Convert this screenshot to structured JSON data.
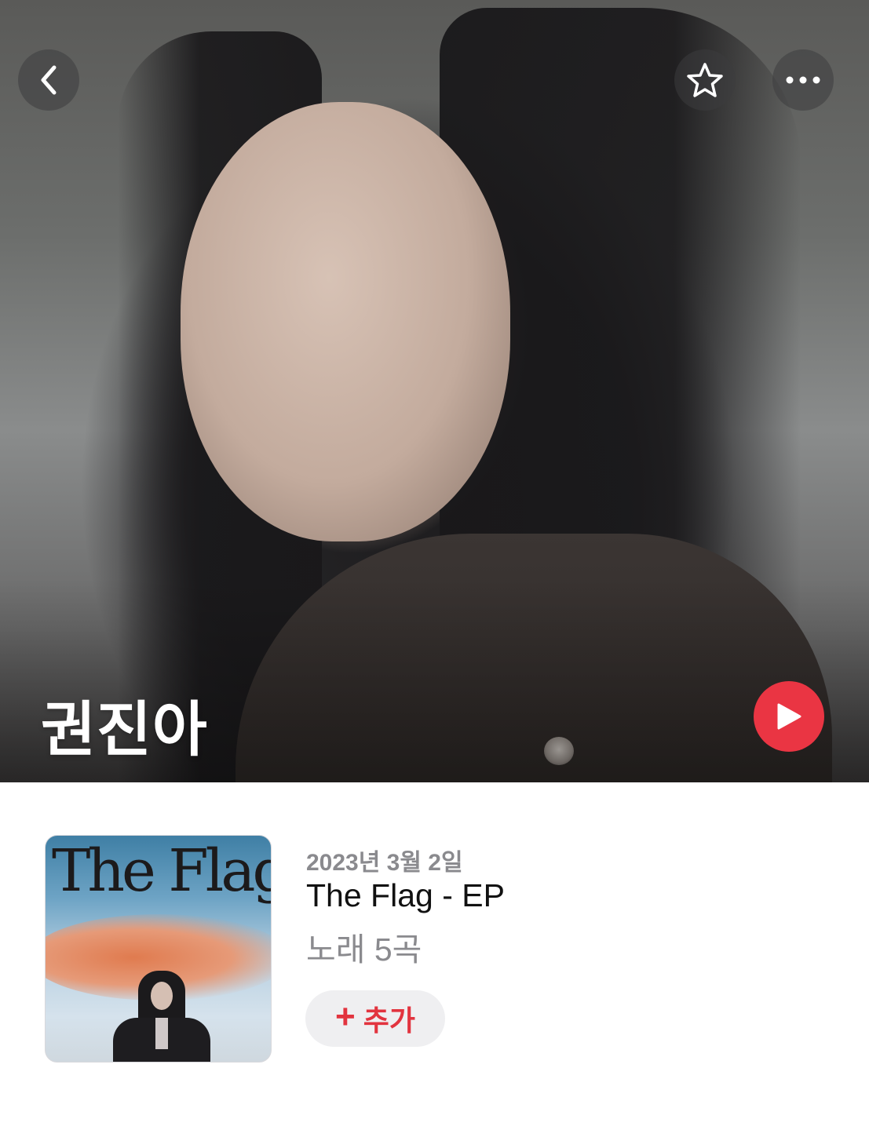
{
  "artist": {
    "name": "권진아"
  },
  "header": {
    "back_icon": "chevron-left-icon",
    "favorite_icon": "star-icon",
    "more_icon": "ellipsis-icon"
  },
  "hero": {
    "play_icon": "play-icon"
  },
  "latest_release": {
    "date": "2023년 3월 2일",
    "title": "The Flag - EP",
    "song_count": "노래 5곡",
    "add_button": {
      "plus": "+",
      "label": "추가"
    },
    "artwork_text": "The Flag"
  },
  "colors": {
    "accent_red": "#ea3543",
    "secondary_text": "#8a8a8e",
    "button_bg": "#efeff1"
  }
}
